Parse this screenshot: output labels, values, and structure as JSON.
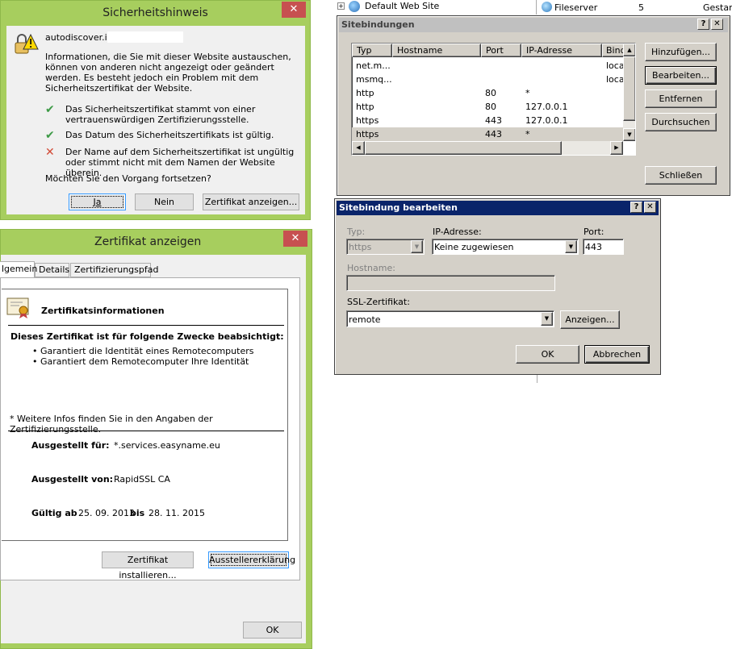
{
  "background": {
    "tree_item": "Default Web Site",
    "server_name": "Fileserver",
    "server_count": "5",
    "server_status": "Gestart"
  },
  "security_alert": {
    "title": "Sicherheitshinweis",
    "close": "✕",
    "host": "autodiscover.i",
    "intro": "Informationen, die Sie mit dieser Website austauschen, können von anderen nicht angezeigt oder geändert werden. Es besteht jedoch ein Problem mit dem Sicherheitszertifikat der Website.",
    "checks": [
      {
        "status": "ok",
        "text": "Das Sicherheitszertifikat stammt von einer vertrauenswürdigen Zertifizierungsstelle."
      },
      {
        "status": "ok",
        "text": "Das Datum des Sicherheitszertifikats ist gültig."
      },
      {
        "status": "error",
        "text": "Der Name auf dem Sicherheitszertifikat ist ungültig oder stimmt nicht mit dem Namen der Website überein."
      }
    ],
    "question": "Möchten Sie den Vorgang fortsetzen?",
    "buttons": {
      "yes": "Ja",
      "no": "Nein",
      "show_cert": "Zertifikat anzeigen..."
    }
  },
  "cert_view": {
    "title": "Zertifikat anzeigen",
    "close": "✕",
    "tabs": [
      "lgemein",
      "Details",
      "Zertifizierungspfad"
    ],
    "info_heading": "Zertifikatsinformationen",
    "purpose_heading": "Dieses Zertifikat ist für folgende Zwecke beabsichtigt:",
    "purposes": [
      "• Garantiert die Identität eines Remotecomputers",
      "• Garantiert dem Remotecomputer Ihre Identität"
    ],
    "more_info": "* Weitere Infos finden Sie in den Angaben der Zertifizierungsstelle.",
    "issued_to_label": "Ausgestellt für:",
    "issued_to": "*.services.easyname.eu",
    "issued_by_label": "Ausgestellt von:",
    "issued_by": "RapidSSL CA",
    "valid_from_label": "Gültig ab",
    "valid_from": "25. 09. 2013",
    "valid_to_label": "bis",
    "valid_to": "28. 11. 2015",
    "buttons": {
      "install": "Zertifikat installieren...",
      "issuer": "Ausstellererklärung",
      "ok": "OK"
    }
  },
  "site_bindings": {
    "title": "Sitebindungen",
    "help": "?",
    "close": "✕",
    "columns": [
      "Typ",
      "Hostname",
      "Port",
      "IP-Adresse",
      "Bind"
    ],
    "rows": [
      {
        "type": "net.m...",
        "host": "",
        "port": "",
        "ip": "",
        "bind": "loca"
      },
      {
        "type": "msmq...",
        "host": "",
        "port": "",
        "ip": "",
        "bind": "loca"
      },
      {
        "type": "http",
        "host": "",
        "port": "80",
        "ip": "*",
        "bind": ""
      },
      {
        "type": "http",
        "host": "",
        "port": "80",
        "ip": "127.0.0.1",
        "bind": ""
      },
      {
        "type": "https",
        "host": "",
        "port": "443",
        "ip": "127.0.0.1",
        "bind": ""
      },
      {
        "type": "https",
        "host": "",
        "port": "443",
        "ip": "*",
        "bind": ""
      }
    ],
    "buttons": {
      "add": "Hinzufügen...",
      "edit": "Bearbeiten...",
      "remove": "Entfernen",
      "browse": "Durchsuchen",
      "close": "Schließen"
    }
  },
  "edit_binding": {
    "title": "Sitebindung bearbeiten",
    "help": "?",
    "close": "✕",
    "type_label": "Typ:",
    "type_value": "https",
    "ip_label": "IP-Adresse:",
    "ip_value": "Keine zugewiesen",
    "port_label": "Port:",
    "port_value": "443",
    "hostname_label": "Hostname:",
    "hostname_value": "",
    "ssl_label": "SSL-Zertifikat:",
    "ssl_value": "remote",
    "buttons": {
      "show": "Anzeigen...",
      "ok": "OK",
      "cancel": "Abbrechen"
    }
  }
}
